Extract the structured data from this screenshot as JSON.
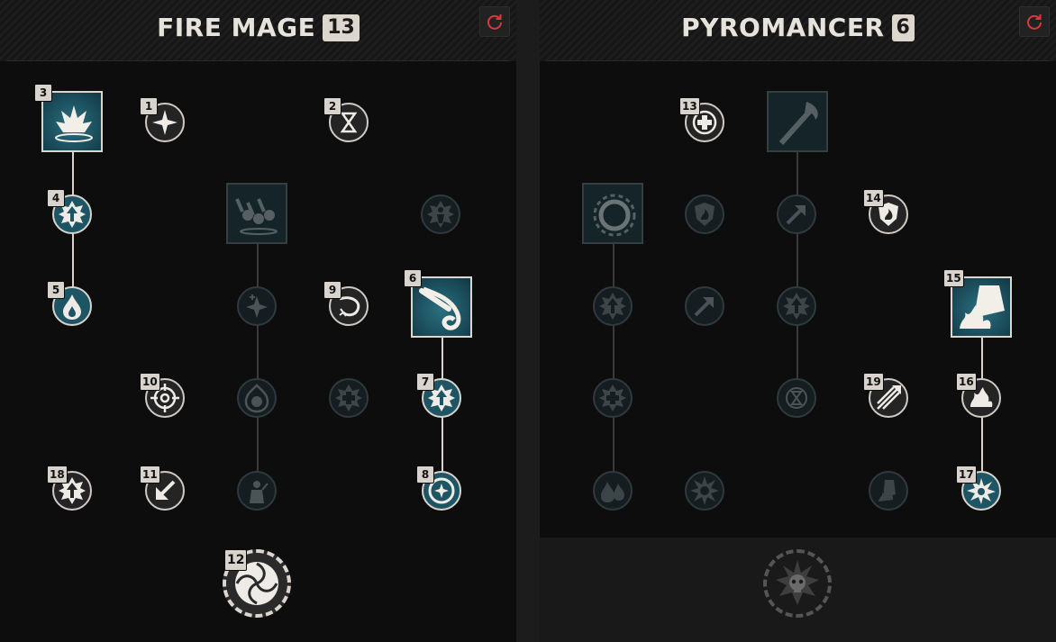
{
  "colors": {
    "accent_blue": "#1d5565",
    "active_border": "#d8d4cd",
    "locked": "#2f3a3e",
    "reset_red": "#d83a3a"
  },
  "panels": [
    {
      "title": "FIRE MAGE",
      "level": "13",
      "reset_icon": "reset-icon",
      "nodes": [
        {
          "id": "fm-n1",
          "shape": "sq",
          "state": "active-blue",
          "badge": "3",
          "icon": "flame-burst-icon"
        },
        {
          "id": "fm-n2",
          "shape": "round",
          "state": "active-white",
          "badge": "1",
          "icon": "sparkle-icon"
        },
        {
          "id": "fm-n3",
          "shape": "round",
          "state": "active-white",
          "badge": "2",
          "icon": "hourglass-icon"
        },
        {
          "id": "fm-n4",
          "shape": "round",
          "state": "active-blue",
          "badge": "4",
          "icon": "arrow-up-burst-icon"
        },
        {
          "id": "fm-n5",
          "shape": "sq",
          "state": "locked",
          "badge": "",
          "icon": "meteor-shower-icon"
        },
        {
          "id": "fm-n6",
          "shape": "round",
          "state": "locked",
          "badge": "",
          "icon": "burning-figure-icon"
        },
        {
          "id": "fm-n7",
          "shape": "round",
          "state": "active-blue",
          "badge": "5",
          "icon": "fire-drop-icon"
        },
        {
          "id": "fm-n8",
          "shape": "round",
          "state": "locked",
          "badge": "",
          "icon": "sparkle-plus-icon"
        },
        {
          "id": "fm-n9",
          "shape": "round",
          "state": "active-white",
          "badge": "9",
          "icon": "swirl-spark-icon"
        },
        {
          "id": "fm-n10",
          "shape": "sq",
          "state": "active-blue",
          "badge": "6",
          "icon": "comet-icon"
        },
        {
          "id": "fm-n11",
          "shape": "round",
          "state": "active-white",
          "badge": "10",
          "icon": "crosshair-icon"
        },
        {
          "id": "fm-n12",
          "shape": "round",
          "state": "locked",
          "badge": "",
          "icon": "flaming-skull-icon"
        },
        {
          "id": "fm-n13",
          "shape": "round",
          "state": "locked",
          "badge": "",
          "icon": "cross-burst-icon"
        },
        {
          "id": "fm-n14",
          "shape": "round",
          "state": "active-blue",
          "badge": "7",
          "icon": "arrow-up-burst-icon"
        },
        {
          "id": "fm-n15",
          "shape": "round",
          "state": "active-white",
          "badge": "18",
          "icon": "arrow-up-burst-icon"
        },
        {
          "id": "fm-n16",
          "shape": "round",
          "state": "active-white",
          "badge": "11",
          "icon": "arrow-down-left-icon"
        },
        {
          "id": "fm-n17",
          "shape": "round",
          "state": "locked",
          "badge": "",
          "icon": "mage-figure-icon"
        },
        {
          "id": "fm-n18",
          "shape": "round",
          "state": "active-blue",
          "badge": "8",
          "icon": "star-circle-icon"
        }
      ],
      "capstone": {
        "badge": "12",
        "state": "active",
        "icon": "vortex-icon"
      }
    },
    {
      "title": "PYROMANCER",
      "level": "6",
      "reset_icon": "reset-icon",
      "nodes": [
        {
          "id": "py-n1",
          "shape": "round",
          "state": "active-white",
          "badge": "13",
          "icon": "medical-cross-icon"
        },
        {
          "id": "py-n2",
          "shape": "sq",
          "state": "locked",
          "badge": "",
          "icon": "flaming-staff-icon"
        },
        {
          "id": "py-n3",
          "shape": "sq",
          "state": "locked",
          "badge": "",
          "icon": "fire-ring-icon"
        },
        {
          "id": "py-n4",
          "shape": "round",
          "state": "locked",
          "badge": "",
          "icon": "fire-shield-icon"
        },
        {
          "id": "py-n5",
          "shape": "round",
          "state": "locked",
          "badge": "",
          "icon": "arrow-up-right-icon"
        },
        {
          "id": "py-n6",
          "shape": "round",
          "state": "active-white",
          "badge": "14",
          "icon": "fire-shield-icon"
        },
        {
          "id": "py-n7",
          "shape": "round",
          "state": "locked",
          "badge": "",
          "icon": "arrow-up-burst-icon"
        },
        {
          "id": "py-n8",
          "shape": "round",
          "state": "locked",
          "badge": "",
          "icon": "arrow-up-right-icon"
        },
        {
          "id": "py-n9",
          "shape": "round",
          "state": "locked",
          "badge": "",
          "icon": "arrow-up-burst-icon"
        },
        {
          "id": "py-n10",
          "shape": "sq",
          "state": "active-blue",
          "badge": "15",
          "icon": "burning-boot-icon"
        },
        {
          "id": "py-n11",
          "shape": "round",
          "state": "locked",
          "badge": "",
          "icon": "cross-burst-icon"
        },
        {
          "id": "py-n12",
          "shape": "round",
          "state": "locked",
          "badge": "",
          "icon": "hourglass-icon"
        },
        {
          "id": "py-n13",
          "shape": "round",
          "state": "active-white",
          "badge": "19",
          "icon": "triple-arrow-icon"
        },
        {
          "id": "py-n14",
          "shape": "round",
          "state": "active-white",
          "badge": "16",
          "icon": "flames-icon"
        },
        {
          "id": "py-n15",
          "shape": "round",
          "state": "locked",
          "badge": "",
          "icon": "fire-drops-icon"
        },
        {
          "id": "py-n16",
          "shape": "round",
          "state": "locked",
          "badge": "",
          "icon": "spiked-ball-icon"
        },
        {
          "id": "py-n17",
          "shape": "round",
          "state": "locked",
          "badge": "",
          "icon": "burning-boot-icon"
        },
        {
          "id": "py-n18",
          "shape": "round",
          "state": "active-blue",
          "badge": "17",
          "icon": "explosion-icon"
        }
      ],
      "capstone": {
        "badge": "",
        "state": "locked",
        "icon": "exploding-skull-icon"
      }
    }
  ]
}
